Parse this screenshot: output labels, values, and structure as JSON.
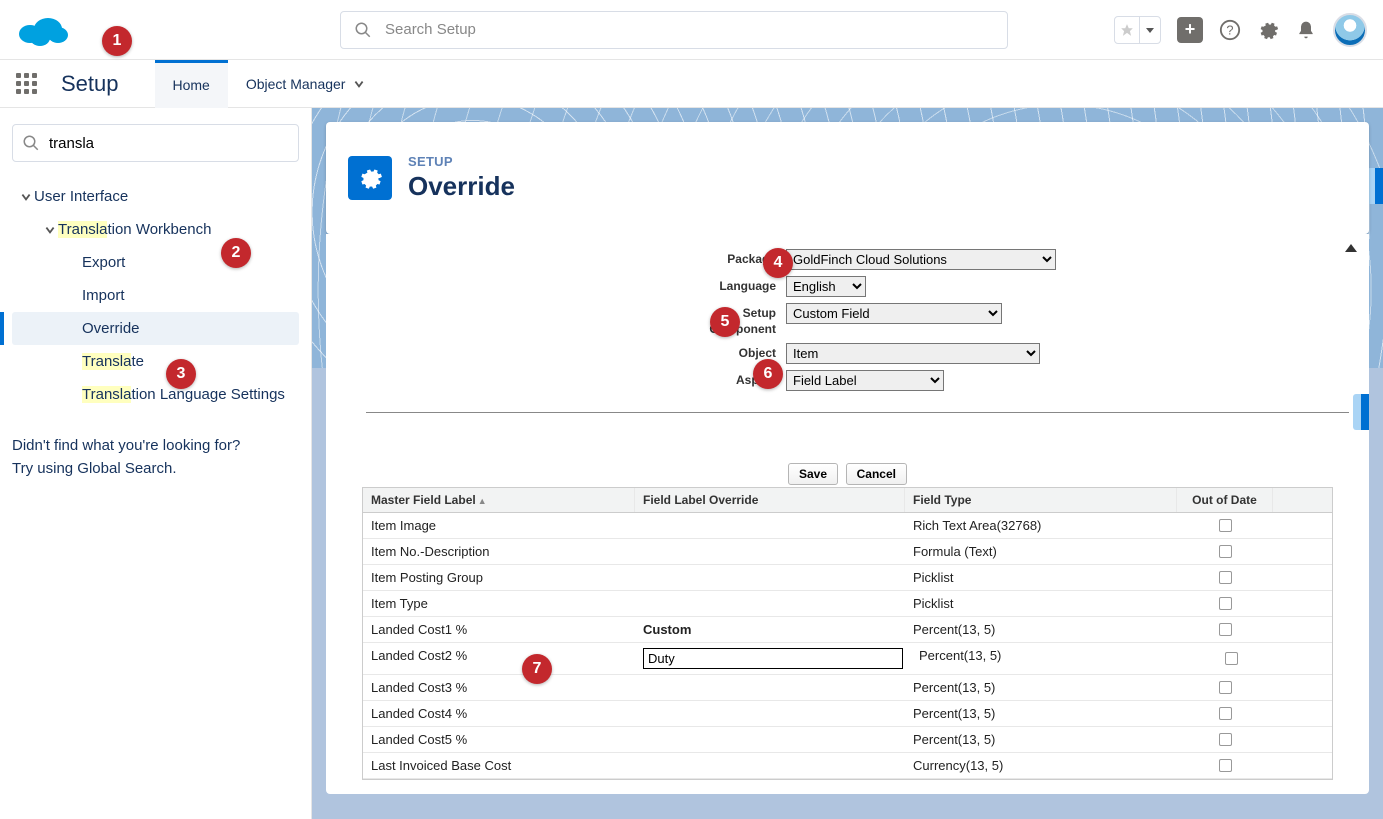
{
  "header": {
    "search_placeholder": "Search Setup"
  },
  "secnav": {
    "setup": "Setup",
    "home": "Home",
    "obj_mgr": "Object Manager"
  },
  "sidebar": {
    "search_value": "transla",
    "ui_label": "User Interface",
    "tw_prefix": "Transla",
    "tw_suffix": "tion Workbench",
    "export": "Export",
    "import": "Import",
    "override": "Override",
    "translate_prefix": "Transla",
    "translate_suffix": "te",
    "tls_prefix": "Transla",
    "tls_suffix": "tion Language Settings",
    "help1": "Didn't find what you're looking for?",
    "help2": "Try using Global Search."
  },
  "page": {
    "eyebrow": "SETUP",
    "title": "Override"
  },
  "form": {
    "package_lbl": "Package",
    "package_val": "GoldFinch Cloud Solutions",
    "language_lbl": "Language",
    "language_val": "English",
    "setupcomp_lbl1": "Setup",
    "setupcomp_lbl2": "Component",
    "setupcomp_val": "Custom Field",
    "object_lbl": "Object",
    "object_val": "Item",
    "aspect_lbl": "Aspect",
    "aspect_val": "Field Label"
  },
  "buttons": {
    "save": "Save",
    "cancel": "Cancel"
  },
  "grid": {
    "h1": "Master Field Label",
    "h2": "Field Label Override",
    "h3": "Field Type",
    "h4": "Out of Date",
    "rows": [
      {
        "label": "Item Image",
        "override": "",
        "type": "Rich Text Area(32768)"
      },
      {
        "label": "Item No.-Description",
        "override": "",
        "type": "Formula (Text)"
      },
      {
        "label": "Item Posting Group",
        "override": "",
        "type": "Picklist"
      },
      {
        "label": "Item Type",
        "override": "",
        "type": "Picklist"
      },
      {
        "label": "Landed Cost1 %",
        "override": "Custom",
        "type": "Percent(13, 5)",
        "highlight": true
      },
      {
        "label": "Landed Cost2 %",
        "override": "Duty",
        "type": "Percent(13, 5)",
        "editing": true
      },
      {
        "label": "Landed Cost3 %",
        "override": "",
        "type": "Percent(13, 5)"
      },
      {
        "label": "Landed Cost4 %",
        "override": "",
        "type": "Percent(13, 5)"
      },
      {
        "label": "Landed Cost5 %",
        "override": "",
        "type": "Percent(13, 5)"
      },
      {
        "label": "Last Invoiced Base Cost",
        "override": "",
        "type": "Currency(13, 5)"
      }
    ]
  },
  "annotations": [
    "1",
    "2",
    "3",
    "4",
    "5",
    "6",
    "7"
  ]
}
